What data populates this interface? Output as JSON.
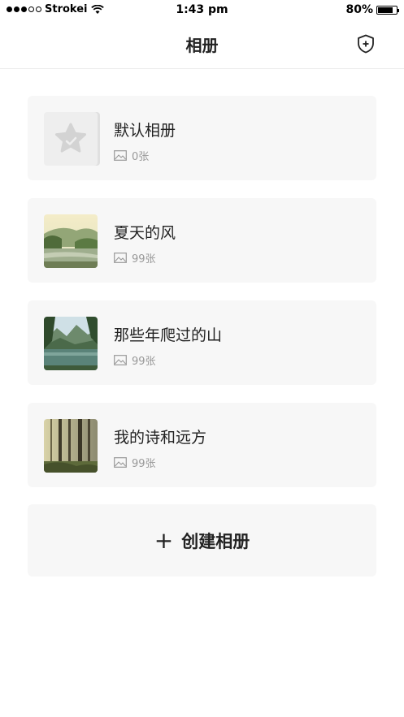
{
  "status_bar": {
    "carrier": "Strokei",
    "time": "1:43 pm",
    "battery": "80%",
    "battery_level": 0.8
  },
  "nav": {
    "title": "相册",
    "right_icon": "shield-plus-icon"
  },
  "albums": [
    {
      "name": "默认相册",
      "count": "0张",
      "thumb": "star-placeholder"
    },
    {
      "name": "夏天的风",
      "count": "99张",
      "thumb": "landscape-lake"
    },
    {
      "name": "那些年爬过的山",
      "count": "99张",
      "thumb": "mountain-lake"
    },
    {
      "name": "我的诗和远方",
      "count": "99张",
      "thumb": "forest-light"
    }
  ],
  "create_button": {
    "icon": "+",
    "label": "创建相册"
  }
}
